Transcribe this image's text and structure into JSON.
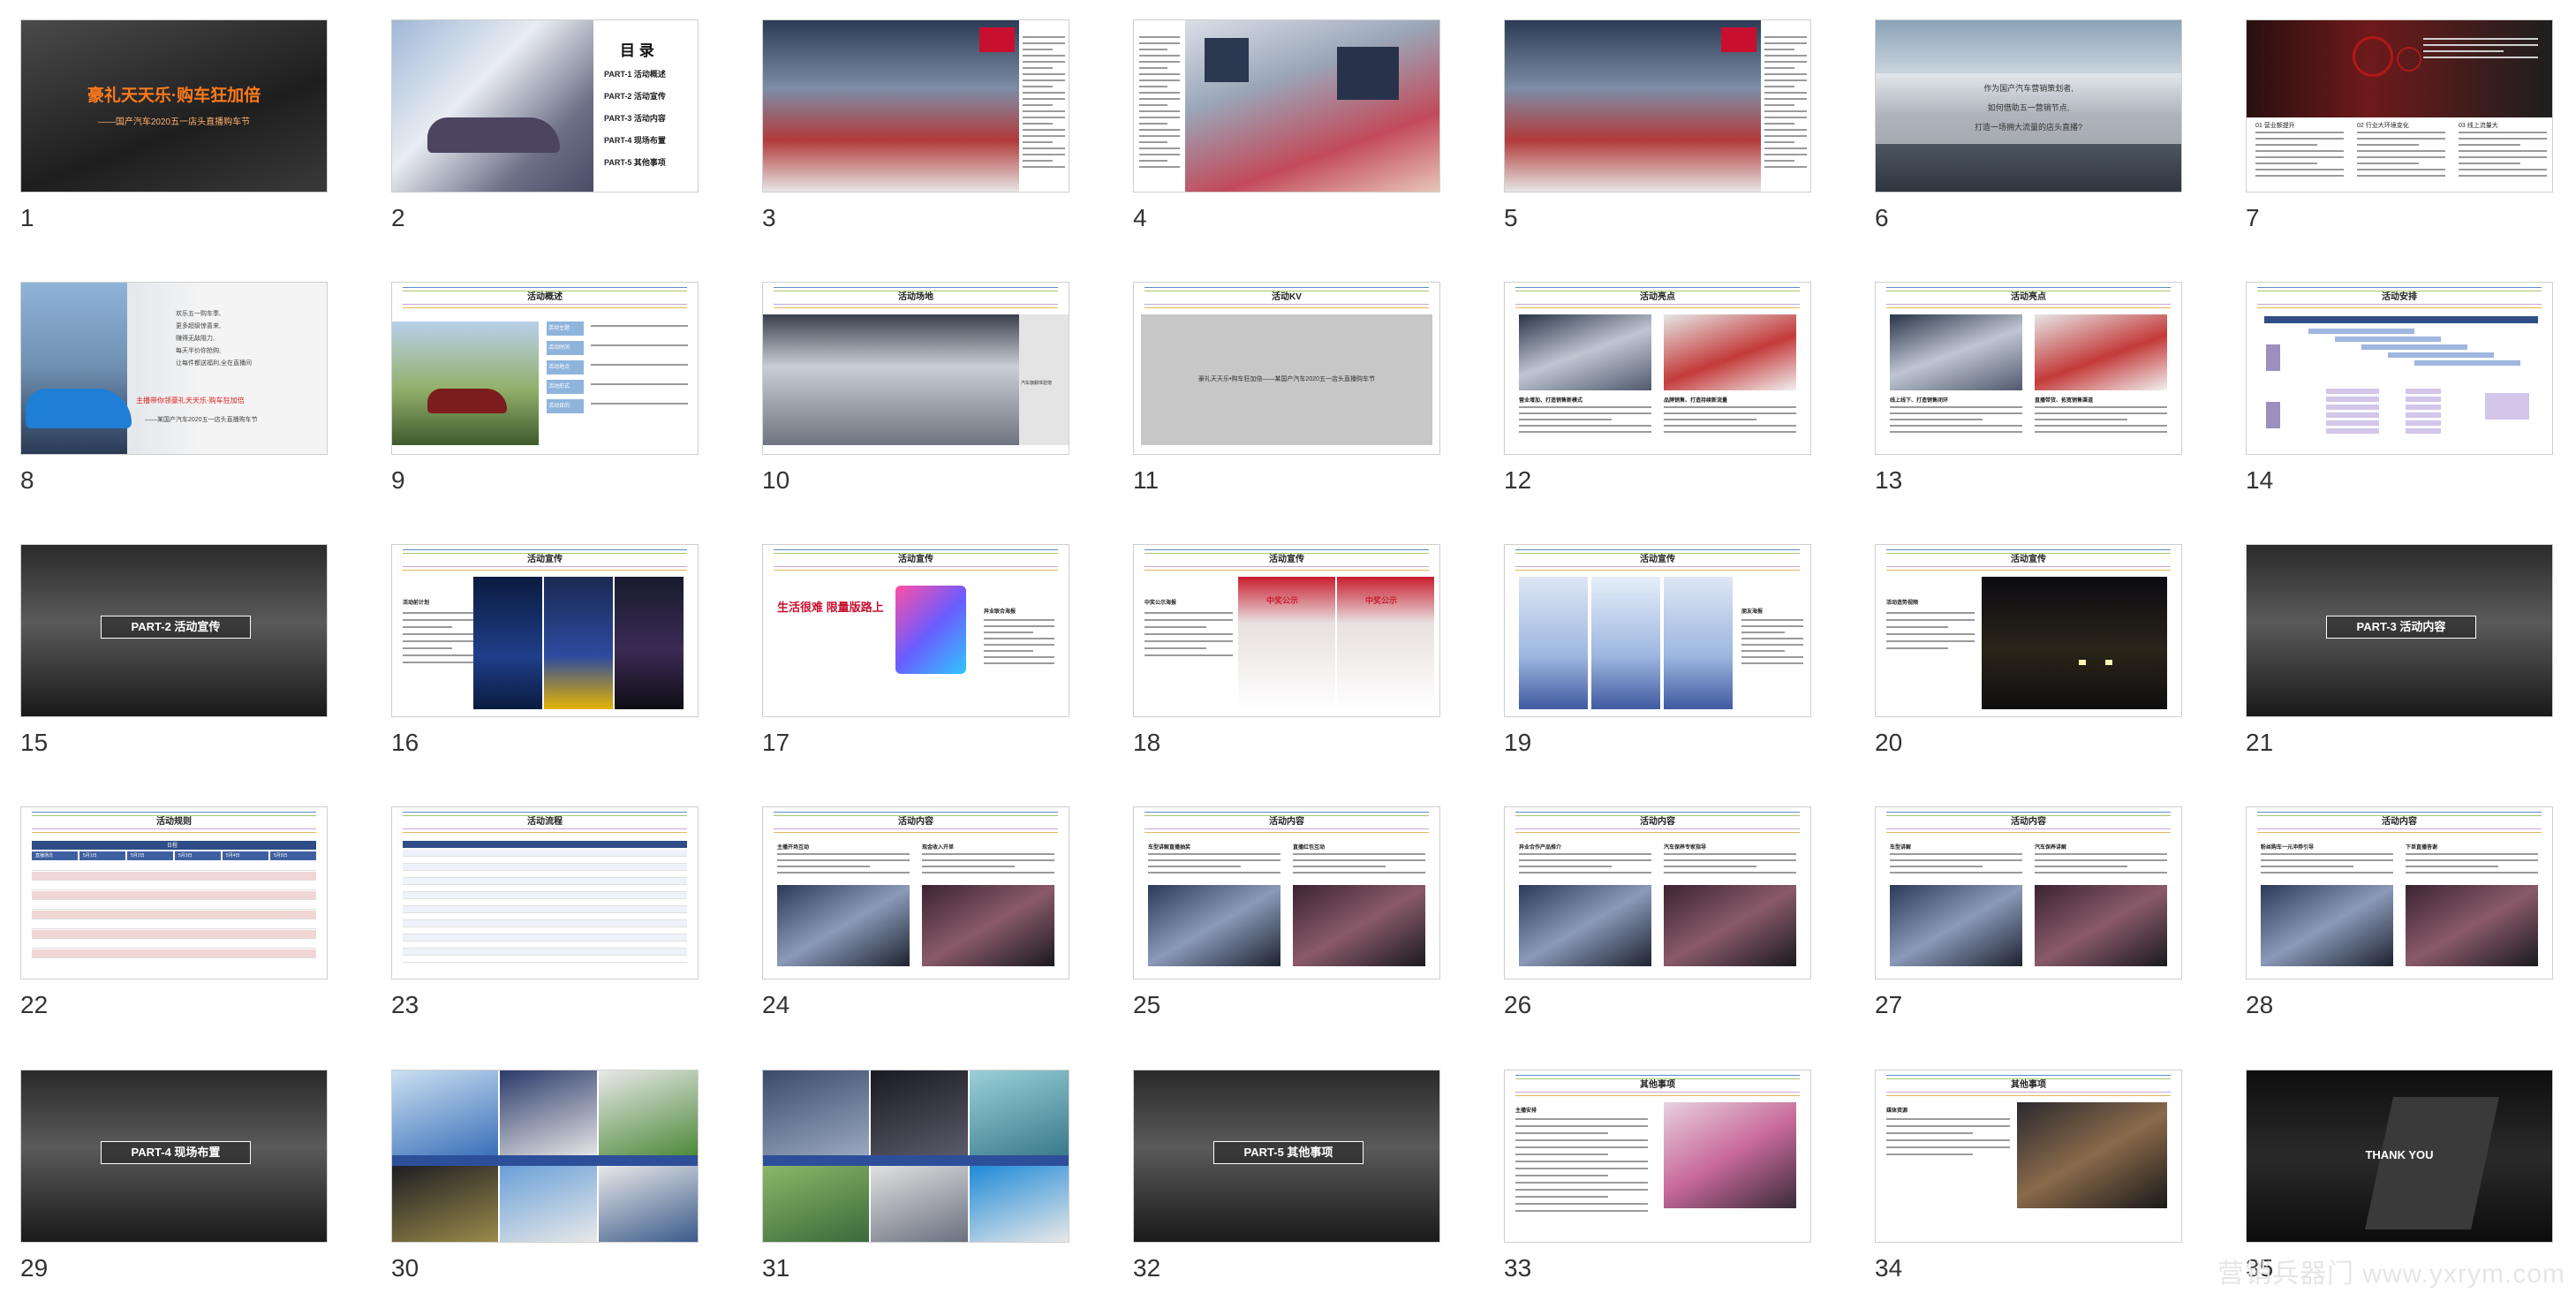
{
  "watermark": "营销兵器门 www.yxrym.com",
  "slides": [
    {
      "n": "1",
      "kind": "cover",
      "title": "豪礼天天乐·购车狂加倍",
      "subtitle": "——国产汽车2020五一店头直播购车节"
    },
    {
      "n": "2",
      "kind": "toc",
      "heading": "目 录",
      "items": [
        "PART-1 活动概述",
        "PART-2 活动宣传",
        "PART-3 活动内容",
        "PART-4 现场布置",
        "PART-5 其他事项"
      ]
    },
    {
      "n": "3",
      "kind": "photo_text",
      "badge": "贵州国际车展"
    },
    {
      "n": "4",
      "kind": "photo_text_left"
    },
    {
      "n": "5",
      "kind": "photo_text",
      "badge": "贵州国际车展"
    },
    {
      "n": "6",
      "kind": "lines",
      "lines": [
        "作为国产汽车营销策划者,",
        "如何借助五一营销节点,",
        "打造一场拥大流量的店头直播?"
      ]
    },
    {
      "n": "7",
      "kind": "red_header",
      "cols": [
        "01 营业额提升",
        "02 行业大环境变化",
        "03 线上流量大"
      ]
    },
    {
      "n": "8",
      "kind": "car_blue",
      "lines": [
        "欢乐五一购车季,",
        "更多超级惊喜来,",
        "赚得无敌阻力,",
        "每天半价你抢购,",
        "让每件都送福利,全在直播间"
      ],
      "highlight": "主播带你领豪礼天天乐·购车狂加倍",
      "sub": "——某国产汽车2020五一店头直播购车节"
    },
    {
      "n": "9",
      "kind": "overview",
      "header": "活动概述",
      "rows": [
        "活动主题",
        "活动时间",
        "活动地点",
        "活动形式",
        "活动目的"
      ]
    },
    {
      "n": "10",
      "kind": "venue",
      "header": "活动场地",
      "side": "汽车旗舰体验馆"
    },
    {
      "n": "11",
      "kind": "kv",
      "header": "活动KV",
      "text": "豪礼天天乐•购车狂加倍——某国产汽车2020五一店头直播购车节"
    },
    {
      "n": "12",
      "kind": "two_photo",
      "header": "活动亮点",
      "caps": [
        "营业增加、打造销售新模式",
        "品牌销售、打造持续新流量"
      ]
    },
    {
      "n": "13",
      "kind": "two_photo",
      "header": "活动亮点",
      "caps": [
        "线上线下、打造销售闭环",
        "直播带货、拓宽销售渠道"
      ]
    },
    {
      "n": "14",
      "kind": "flow",
      "header": "活动安排"
    },
    {
      "n": "15",
      "kind": "part",
      "label": "PART-2  活动宣传"
    },
    {
      "n": "16",
      "kind": "posters",
      "header": "活动宣传",
      "left": "活动前计划"
    },
    {
      "n": "17",
      "kind": "promo",
      "header": "活动宣传",
      "big": "生活很难 限量版路上",
      "right": "异业联合海报"
    },
    {
      "n": "18",
      "kind": "prize",
      "header": "活动宣传",
      "left": "中奖公示海报",
      "p1": "中奖公示",
      "p2": "中奖公示"
    },
    {
      "n": "19",
      "kind": "persons",
      "header": "活动宣传",
      "right": "朋友海报"
    },
    {
      "n": "20",
      "kind": "night",
      "header": "活动宣传",
      "left": "活动造势视频"
    },
    {
      "n": "21",
      "kind": "part",
      "label": "PART-3  活动内容"
    },
    {
      "n": "22",
      "kind": "table",
      "header": "活动规则",
      "thead": "日程",
      "cols": [
        "直播场次",
        "5月1日",
        "5月2日",
        "5月3日",
        "5月4日",
        "5月5日"
      ]
    },
    {
      "n": "23",
      "kind": "table2",
      "header": "活动流程"
    },
    {
      "n": "24",
      "kind": "content",
      "header": "活动内容",
      "caps": [
        "主播开场互动",
        "现金收入开单"
      ]
    },
    {
      "n": "25",
      "kind": "content",
      "header": "活动内容",
      "caps": [
        "车型讲解直播抽奖",
        "直播红包互动"
      ]
    },
    {
      "n": "26",
      "kind": "content",
      "header": "活动内容",
      "caps": [
        "异业合作产品推介",
        "汽车保养专家指导"
      ]
    },
    {
      "n": "27",
      "kind": "content",
      "header": "活动内容",
      "caps": [
        "车型讲解",
        "汽车保养讲解"
      ]
    },
    {
      "n": "28",
      "kind": "content",
      "header": "活动内容",
      "caps": [
        "粉丝购车一元冲券引导",
        "下单直播答谢"
      ]
    },
    {
      "n": "29",
      "kind": "part",
      "label": "PART-4 现场布置"
    },
    {
      "n": "30",
      "kind": "collage"
    },
    {
      "n": "31",
      "kind": "collage2"
    },
    {
      "n": "32",
      "kind": "part",
      "label": "PART-5 其他事项"
    },
    {
      "n": "33",
      "kind": "other",
      "header": "其他事项",
      "left": "主播安排"
    },
    {
      "n": "34",
      "kind": "other2",
      "header": "其他事项",
      "left": "媒体资源"
    },
    {
      "n": "35",
      "kind": "thanks",
      "text": "THANK YOU"
    }
  ]
}
